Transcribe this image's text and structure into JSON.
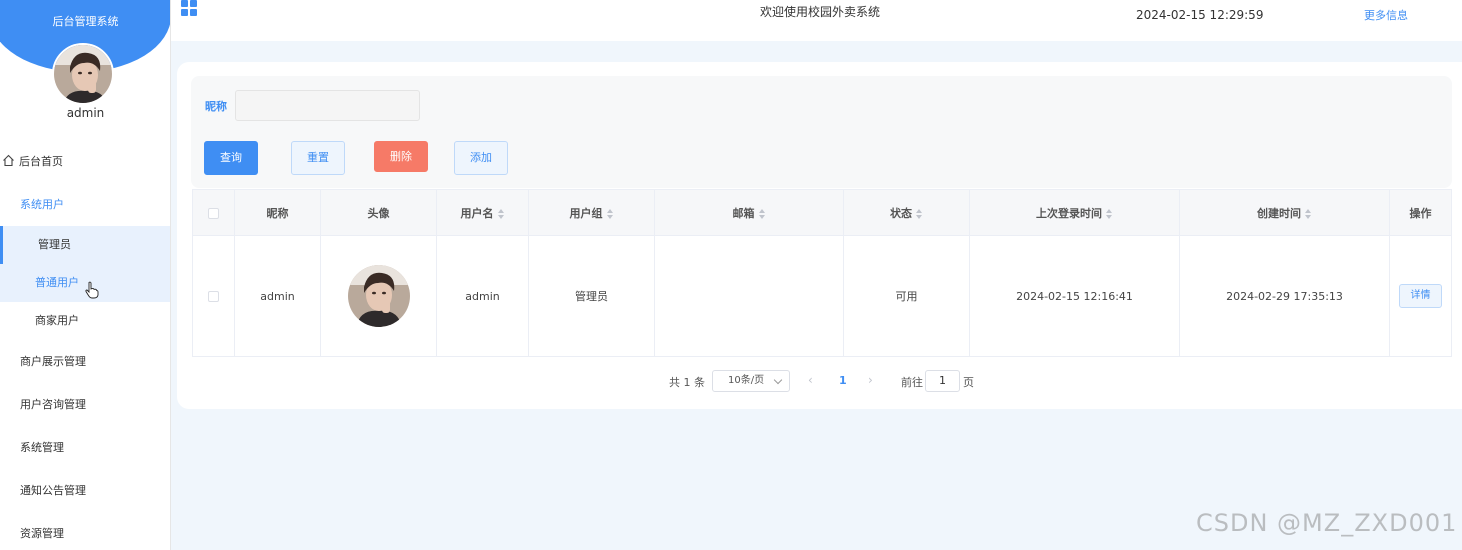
{
  "sidebar": {
    "brand_title": "后台管理系统",
    "user_name": "admin",
    "menu": {
      "home": "后台首页",
      "system_users": "系统用户",
      "sub_admin": "管理员",
      "sub_normal": "普通用户",
      "sub_merchant": "商家用户",
      "merchant_display": "商户展示管理",
      "user_consult": "用户咨询管理",
      "system_manage": "系统管理",
      "notice_manage": "通知公告管理",
      "resource_manage": "资源管理"
    }
  },
  "topbar": {
    "welcome": "欢迎使用校园外卖系统",
    "datetime": "2024-02-15 12:29:59",
    "more_info": "更多信息"
  },
  "filter": {
    "nickname_label": "昵称",
    "nickname_value": "",
    "buttons": {
      "query": "查询",
      "reset": "重置",
      "delete": "删除",
      "add": "添加"
    }
  },
  "table": {
    "headers": {
      "nickname": "昵称",
      "avatar": "头像",
      "username": "用户名",
      "user_group": "用户组",
      "email": "邮箱",
      "status": "状态",
      "last_login": "上次登录时间",
      "created": "创建时间",
      "actions": "操作"
    },
    "rows": [
      {
        "nickname": "admin",
        "username": "admin",
        "user_group": "管理员",
        "email": "",
        "status": "可用",
        "last_login": "2024-02-15 12:16:41",
        "created": "2024-02-29 17:35:13",
        "action": "详情"
      }
    ]
  },
  "pagination": {
    "total": "共 1 条",
    "page_size": "10条/页",
    "current_page": "1",
    "goto_prefix": "前往",
    "goto_value": "1",
    "goto_suffix": "页"
  },
  "watermark": "CSDN @MZ_ZXD001",
  "colors": {
    "primary": "#3f8ef3",
    "danger": "#f67a67",
    "background": "#f0f6fc"
  },
  "icons": {
    "home": "home-icon",
    "grid": "grid-menu-icon",
    "cursor": "hand-cursor-icon"
  }
}
